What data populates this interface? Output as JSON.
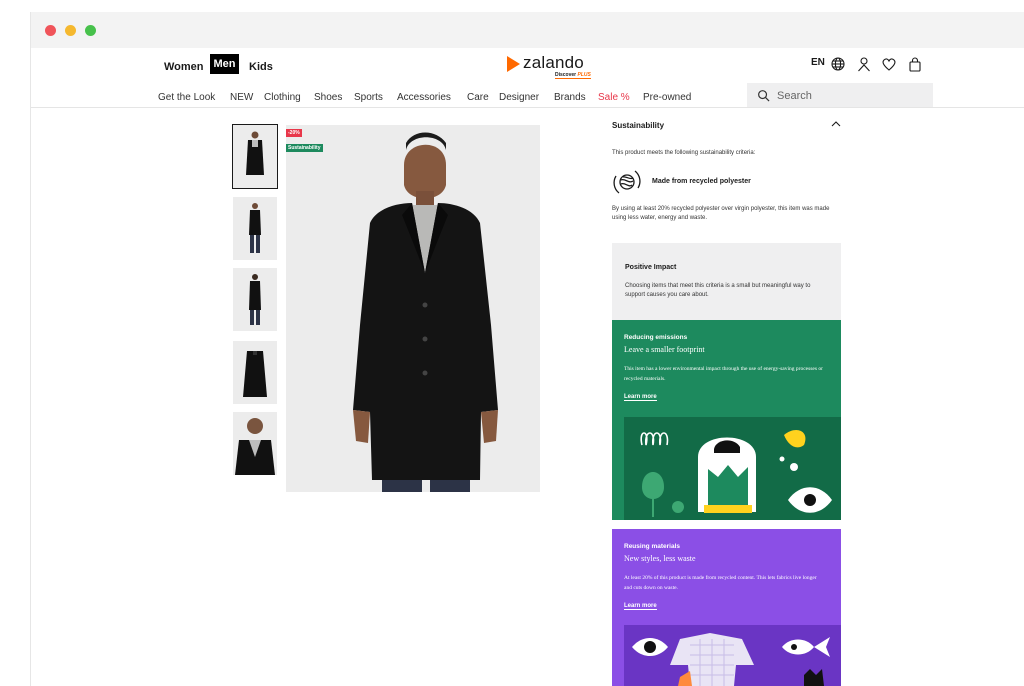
{
  "browser": {
    "buttons": [
      "close",
      "minimize",
      "maximize"
    ]
  },
  "header": {
    "gender_tabs": [
      {
        "label": "Women",
        "selected": false
      },
      {
        "label": "Men",
        "selected": true
      },
      {
        "label": "Kids",
        "selected": false
      }
    ],
    "logo": {
      "text": "zalando",
      "sub": "Discover",
      "plus": "PLUS"
    },
    "lang": "EN",
    "icons": [
      "globe-icon",
      "user-icon",
      "heart-icon",
      "bag-icon"
    ]
  },
  "nav": {
    "items": [
      "Get the Look",
      "NEW",
      "Clothing",
      "Shoes",
      "Sports",
      "Accessories",
      "Care",
      "Designer",
      "Brands",
      "Sale %",
      "Pre-owned"
    ],
    "search_placeholder": "Search"
  },
  "product": {
    "flags": {
      "discount": "-20%",
      "sustainability": "Sustainability"
    },
    "thumbnail_count": 5
  },
  "sustainability": {
    "title": "Sustainability",
    "intro": "This product meets the following sustainability criteria:",
    "criterion": "Made from recycled polyester",
    "description": "By using at least 20% recycled polyester over virgin polyester, this item was made using less water, energy and waste.",
    "impact": {
      "title": "Positive Impact",
      "text": "Choosing items that meet this criteria is a small but meaningful way to support causes you care about."
    },
    "cards": [
      {
        "title": "Reducing emissions",
        "subtitle": "Leave a smaller footprint",
        "text": "This item has a lower environmental impact through the use of energy-saving processes or recycled materials.",
        "link": "Learn more",
        "color": "#1d8a5e"
      },
      {
        "title": "Reusing materials",
        "subtitle": "New styles, less waste",
        "text": "At least 20% of this product is made from recycled content. This lets fabrics live longer and cuts down on waste.",
        "link": "Learn more",
        "color": "#8b4fe6"
      }
    ]
  }
}
